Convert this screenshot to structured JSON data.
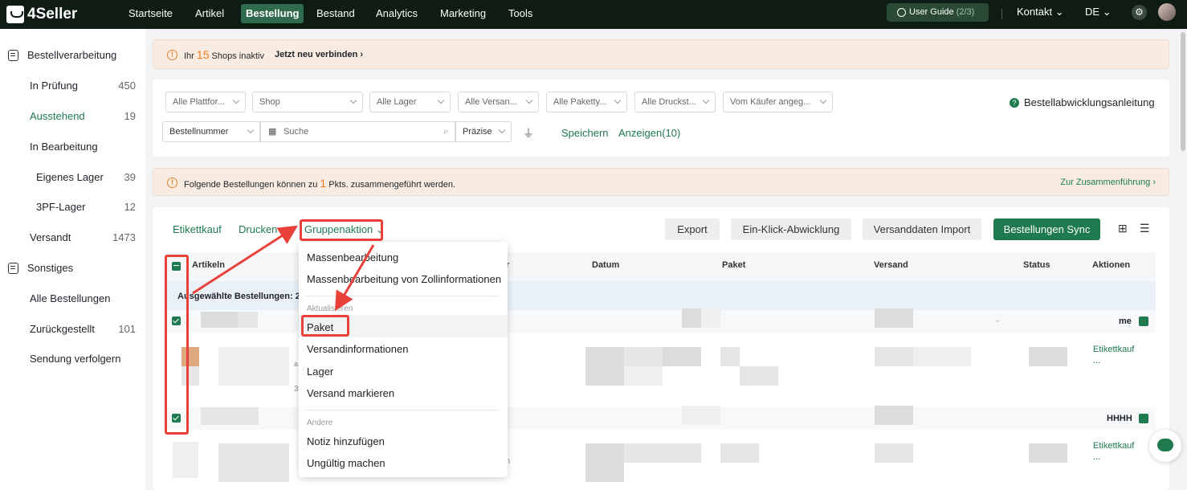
{
  "topnav": {
    "logo": "4Seller",
    "items": [
      "Startseite",
      "Artikel",
      "Bestellung",
      "Bestand",
      "Analytics",
      "Marketing",
      "Tools"
    ],
    "guide_label": "User Guide",
    "guide_count": "(2/3)",
    "kontakt": "Kontakt",
    "lang": "DE"
  },
  "sidebar": {
    "group1": "Bestellverarbeitung",
    "items": [
      {
        "label": "In Prüfung",
        "count": "450"
      },
      {
        "label": "Ausstehend",
        "count": "19"
      },
      {
        "label": "In Bearbeitung",
        "count": ""
      },
      {
        "label": "Eigenes Lager",
        "count": "39"
      },
      {
        "label": "3PF-Lager",
        "count": "12"
      },
      {
        "label": "Versandt",
        "count": "1473"
      }
    ],
    "group2": "Sonstiges",
    "items2": [
      {
        "label": "Alle Bestellungen",
        "count": ""
      },
      {
        "label": "Zurückgestellt",
        "count": "101"
      },
      {
        "label": "Sendung verfolgern",
        "count": ""
      }
    ]
  },
  "banner1": {
    "pre": "Ihr",
    "num": "15",
    "post": "Shops inaktiv",
    "link": "Jetzt neu verbinden"
  },
  "filters": {
    "selects": [
      "Alle Plattfor...",
      "Shop",
      "Alle Lager",
      "Alle Versan...",
      "Alle Paketty...",
      "Alle Druckst...",
      "Vom Käufer angeg..."
    ],
    "order_field": "Bestellnummer",
    "search_placeholder": "Suche",
    "precision": "Präzise",
    "save": "Speichern",
    "show": "Anzeigen(10)",
    "guide": "Bestellabwicklungsanleitung"
  },
  "banner2": {
    "pre": "Folgende Bestellungen können zu",
    "num": "1",
    "post": "Pkts. zusammengeführt werden.",
    "link": "Zur Zusammenführung"
  },
  "toolbar": {
    "label_buy": "Etikettkauf",
    "print": "Drucken",
    "group_action": "Gruppenaktion",
    "export": "Export",
    "one_click": "Ein-Klick-Abwicklung",
    "import": "Versanddaten Import",
    "sync": "Bestellungen Sync"
  },
  "table": {
    "headers": [
      "Artikeln",
      "r",
      "Datum",
      "Paket",
      "Versand",
      "Status",
      "Aktionen"
    ],
    "selected_label": "Ausgewählte Bestellungen:",
    "selected_count": "2",
    "row_notes": [
      "me",
      "HHHH"
    ],
    "row_action": "Etikettkauf",
    "row_more": "...",
    "fragments": [
      "a",
      "3",
      "on"
    ]
  },
  "menu": {
    "items1": [
      "Massenbearbeitung",
      "Massenbearbeitung von Zollinformationen"
    ],
    "header2": "Aktualisieren",
    "items2": [
      "Paket",
      "Versandinformationen",
      "Lager",
      "Versand markieren"
    ],
    "header3": "Andere",
    "items3": [
      "Notiz hinzufügen",
      "Ungültig machen"
    ]
  }
}
